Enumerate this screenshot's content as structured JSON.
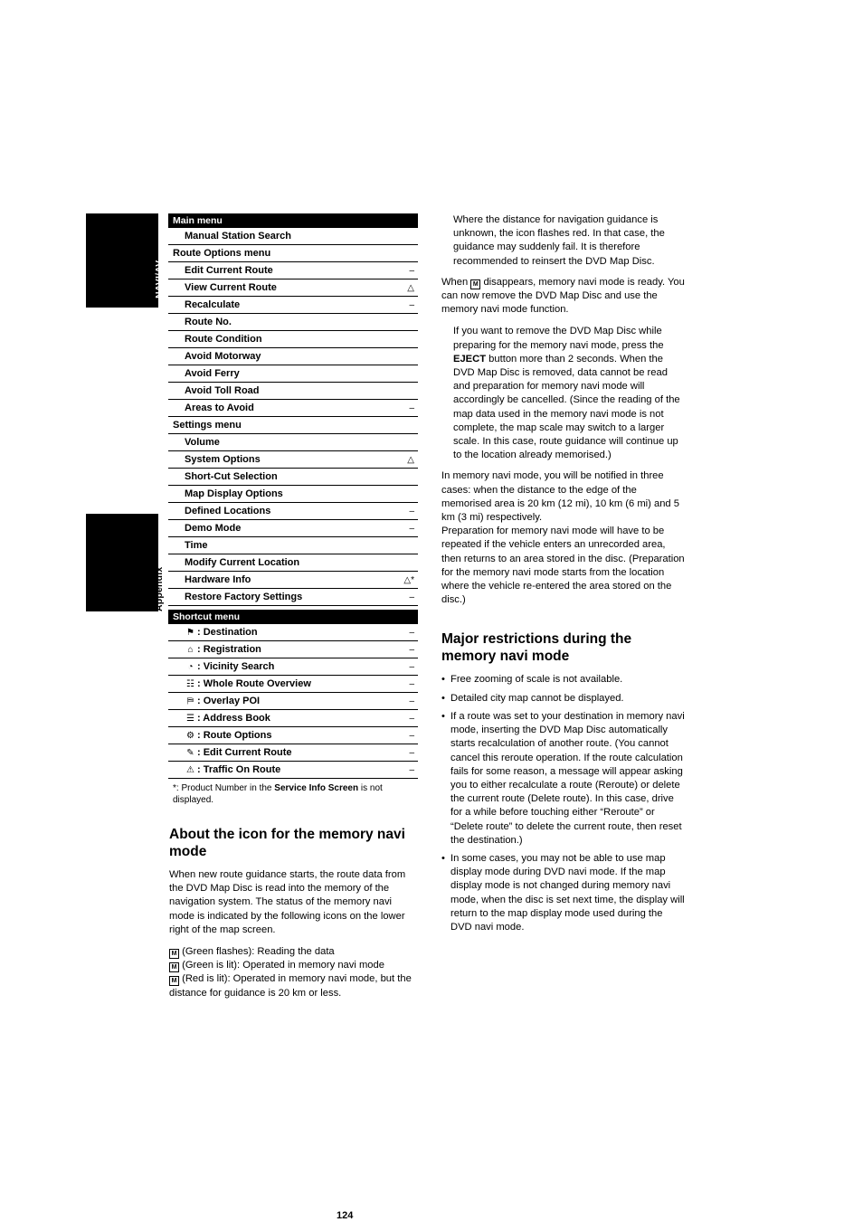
{
  "sidebar": {
    "tab_navi": "NAVI/AV",
    "tab_appendix": "Appendix"
  },
  "page_number": "124",
  "main_menu": {
    "header": "Main menu",
    "rows": [
      {
        "label": "Manual Station Search",
        "mark": "",
        "indent": 1
      },
      {
        "label": "Route Options menu",
        "mark": "",
        "indent": 0
      },
      {
        "label": "Edit Current Route",
        "mark": "–",
        "indent": 1
      },
      {
        "label": "View Current Route",
        "mark": "△",
        "indent": 1
      },
      {
        "label": "Recalculate",
        "mark": "–",
        "indent": 1
      },
      {
        "label": "Route No.",
        "mark": "",
        "indent": 1
      },
      {
        "label": "Route Condition",
        "mark": "",
        "indent": 1
      },
      {
        "label": "Avoid Motorway",
        "mark": "",
        "indent": 1
      },
      {
        "label": "Avoid Ferry",
        "mark": "",
        "indent": 1
      },
      {
        "label": "Avoid Toll Road",
        "mark": "",
        "indent": 1
      },
      {
        "label": "Areas to Avoid",
        "mark": "–",
        "indent": 1
      },
      {
        "label": "Settings menu",
        "mark": "",
        "indent": 0
      },
      {
        "label": "Volume",
        "mark": "",
        "indent": 1
      },
      {
        "label": "System Options",
        "mark": "△",
        "indent": 1
      },
      {
        "label": "Short-Cut Selection",
        "mark": "",
        "indent": 1
      },
      {
        "label": "Map Display Options",
        "mark": "",
        "indent": 1
      },
      {
        "label": "Defined Locations",
        "mark": "–",
        "indent": 1
      },
      {
        "label": "Demo Mode",
        "mark": "–",
        "indent": 1
      },
      {
        "label": "Time",
        "mark": "",
        "indent": 1
      },
      {
        "label": "Modify Current Location",
        "mark": "",
        "indent": 1
      },
      {
        "label": "Hardware Info",
        "mark": "△*",
        "indent": 1
      },
      {
        "label": "Restore Factory Settings",
        "mark": "–",
        "indent": 1
      }
    ]
  },
  "shortcut_menu": {
    "header": "Shortcut menu",
    "rows": [
      {
        "icon": "⚑",
        "label": ": Destination",
        "mark": "–"
      },
      {
        "icon": "⌂",
        "label": ": Registration",
        "mark": "–"
      },
      {
        "icon": "◔",
        "label": ": Vicinity Search",
        "mark": "–"
      },
      {
        "icon": "☷",
        "label": ": Whole Route Overview",
        "mark": "–"
      },
      {
        "icon": "⛿",
        "label": ": Overlay POI",
        "mark": "–"
      },
      {
        "icon": "☰",
        "label": ": Address Book",
        "mark": "–"
      },
      {
        "icon": "⚙",
        "label": ": Route Options",
        "mark": "–"
      },
      {
        "icon": "✎",
        "label": ": Edit Current Route",
        "mark": "–"
      },
      {
        "icon": "⚠",
        "label": ": Traffic On Route",
        "mark": "–"
      }
    ],
    "footnote_pre": "*: Product Number in the ",
    "footnote_bold": "Service Info Screen",
    "footnote_post": " is not displayed."
  },
  "left_article": {
    "heading": "About the icon for the memory navi mode",
    "p1": "When new route guidance starts, the route data from the DVD Map Disc is read into the memory of the navigation system. The status of the memory navi mode is indicated by the following icons on the lower right of the map screen.",
    "icon_lines": [
      {
        "glyph": "M",
        "text": "(Green flashes): Reading the data"
      },
      {
        "glyph": "M",
        "text": "(Green is lit): Operated in memory navi mode"
      },
      {
        "glyph": "M",
        "text": "(Red is lit): Operated in memory navi mode, but the distance for guidance is 20 km or less."
      }
    ]
  },
  "right_column": {
    "p1": "Where the distance for navigation guidance is unknown, the icon flashes red. In that case, the guidance may suddenly fail. It is therefore recommended to reinsert the DVD Map Disc.",
    "p2_pre": "When ",
    "p2_glyph": "M",
    "p2_post": " disappears, memory navi mode is ready. You can now remove the DVD Map Disc and use the memory navi mode function.",
    "p3_pre": "If you want to remove the DVD Map Disc while preparing for the memory navi mode, press the ",
    "p3_bold": "EJECT",
    "p3_post": " button more than 2 seconds. When the DVD Map Disc is removed, data cannot be read and preparation for memory navi mode will accordingly be cancelled. (Since the reading of the map data used in the memory navi mode is not complete, the map scale may switch to a larger scale. In this case, route guidance will continue up to the location already memorised.)",
    "p4": "In memory navi mode, you will be notified in three cases: when the distance to the edge of the memorised area is 20 km (12 mi), 10 km (6 mi) and 5 km (3 mi) respectively.",
    "p5": "Preparation for memory navi mode will have to be repeated if the vehicle enters an unrecorded area, then returns to an area stored in the disc. (Preparation for the memory navi mode starts from the location where the vehicle re-entered the area stored on the disc.)",
    "heading": "Major restrictions during the memory navi mode",
    "bullets": [
      "Free zooming of scale is not available.",
      "Detailed city map cannot be displayed.",
      "If a route was set to your destination in memory navi mode, inserting the DVD Map Disc automatically starts recalculation of another route. (You cannot cancel this reroute operation. If the route calculation fails for some reason, a message will appear asking you to either recalculate a route (Reroute) or delete the current route (Delete route). In this case, drive for a while before touching either “Reroute” or “Delete route” to delete the current route, then reset the destination.)",
      "In some cases, you may not be able to use map display mode during DVD navi mode. If the map display mode is not changed during memory navi mode, when the disc is set next time, the display will return to the map display mode used during the DVD navi mode."
    ]
  }
}
